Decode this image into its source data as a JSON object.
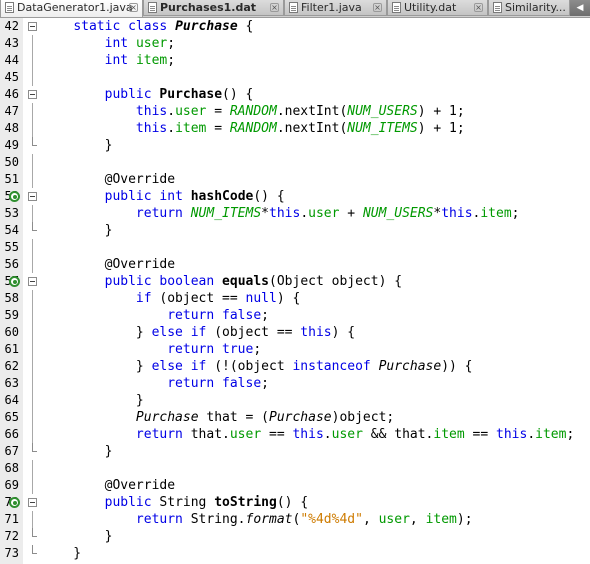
{
  "tabs": [
    {
      "label": "DataGenerator1.java",
      "active": true,
      "bold": false,
      "close": "×"
    },
    {
      "label": "Purchases1.dat",
      "active": false,
      "bold": true,
      "close": "×"
    },
    {
      "label": "Filter1.java",
      "active": false,
      "bold": false,
      "close": "×"
    },
    {
      "label": "Utility.dat",
      "active": false,
      "bold": false,
      "close": "×"
    },
    {
      "label": "Similarity...",
      "active": false,
      "bold": false,
      "close": "×"
    }
  ],
  "tab_scroll_arrow": "◀",
  "code_lines": [
    {
      "num": "42",
      "fold": "start",
      "tokens": [
        [
          "plain",
          "    "
        ],
        [
          "kw",
          "static"
        ],
        [
          "plain",
          " "
        ],
        [
          "kw",
          "class"
        ],
        [
          "plain",
          " "
        ],
        [
          "bcls",
          "Purchase"
        ],
        [
          "plain",
          " {"
        ]
      ]
    },
    {
      "num": "43",
      "fold": "line",
      "tokens": [
        [
          "plain",
          "        "
        ],
        [
          "kw",
          "int"
        ],
        [
          "plain",
          " "
        ],
        [
          "field",
          "user"
        ],
        [
          "plain",
          ";"
        ]
      ]
    },
    {
      "num": "44",
      "fold": "line",
      "tokens": [
        [
          "plain",
          "        "
        ],
        [
          "kw",
          "int"
        ],
        [
          "plain",
          " "
        ],
        [
          "field",
          "item"
        ],
        [
          "plain",
          ";"
        ]
      ]
    },
    {
      "num": "45",
      "fold": "line",
      "tokens": []
    },
    {
      "num": "46",
      "fold": "start",
      "tokens": [
        [
          "plain",
          "        "
        ],
        [
          "kw",
          "public"
        ],
        [
          "plain",
          " "
        ],
        [
          "meth",
          "Purchase"
        ],
        [
          "plain",
          "() {"
        ]
      ]
    },
    {
      "num": "47",
      "fold": "line",
      "tokens": [
        [
          "plain",
          "            "
        ],
        [
          "kw",
          "this"
        ],
        [
          "plain",
          "."
        ],
        [
          "field",
          "user"
        ],
        [
          "plain",
          " = "
        ],
        [
          "const",
          "RANDOM"
        ],
        [
          "plain",
          ".nextInt("
        ],
        [
          "const",
          "NUM_USERS"
        ],
        [
          "plain",
          ") + 1;"
        ]
      ]
    },
    {
      "num": "48",
      "fold": "line",
      "tokens": [
        [
          "plain",
          "            "
        ],
        [
          "kw",
          "this"
        ],
        [
          "plain",
          "."
        ],
        [
          "field",
          "item"
        ],
        [
          "plain",
          " = "
        ],
        [
          "const",
          "RANDOM"
        ],
        [
          "plain",
          ".nextInt("
        ],
        [
          "const",
          "NUM_ITEMS"
        ],
        [
          "plain",
          ") + 1;"
        ]
      ]
    },
    {
      "num": "49",
      "fold": "end",
      "tokens": [
        [
          "plain",
          "        }"
        ]
      ]
    },
    {
      "num": "50",
      "fold": "line",
      "tokens": []
    },
    {
      "num": "51",
      "fold": "line",
      "tokens": [
        [
          "plain",
          "        "
        ],
        [
          "ann",
          "@Override"
        ]
      ]
    },
    {
      "num": "52",
      "fold": "start",
      "override": true,
      "tokens": [
        [
          "plain",
          "        "
        ],
        [
          "kw",
          "public"
        ],
        [
          "plain",
          " "
        ],
        [
          "kw",
          "int"
        ],
        [
          "plain",
          " "
        ],
        [
          "meth",
          "hashCode"
        ],
        [
          "plain",
          "() {"
        ]
      ]
    },
    {
      "num": "53",
      "fold": "line",
      "tokens": [
        [
          "plain",
          "            "
        ],
        [
          "kw",
          "return"
        ],
        [
          "plain",
          " "
        ],
        [
          "const",
          "NUM_ITEMS"
        ],
        [
          "plain",
          "*"
        ],
        [
          "kw",
          "this"
        ],
        [
          "plain",
          "."
        ],
        [
          "field",
          "user"
        ],
        [
          "plain",
          " + "
        ],
        [
          "const",
          "NUM_USERS"
        ],
        [
          "plain",
          "*"
        ],
        [
          "kw",
          "this"
        ],
        [
          "plain",
          "."
        ],
        [
          "field",
          "item"
        ],
        [
          "plain",
          ";"
        ]
      ]
    },
    {
      "num": "54",
      "fold": "end",
      "tokens": [
        [
          "plain",
          "        }"
        ]
      ]
    },
    {
      "num": "55",
      "fold": "line",
      "tokens": []
    },
    {
      "num": "56",
      "fold": "line",
      "tokens": [
        [
          "plain",
          "        "
        ],
        [
          "ann",
          "@Override"
        ]
      ]
    },
    {
      "num": "57",
      "fold": "start",
      "override": true,
      "tokens": [
        [
          "plain",
          "        "
        ],
        [
          "kw",
          "public"
        ],
        [
          "plain",
          " "
        ],
        [
          "kw",
          "boolean"
        ],
        [
          "plain",
          " "
        ],
        [
          "meth",
          "equals"
        ],
        [
          "plain",
          "(Object object) {"
        ]
      ]
    },
    {
      "num": "58",
      "fold": "line",
      "tokens": [
        [
          "plain",
          "            "
        ],
        [
          "kw",
          "if"
        ],
        [
          "plain",
          " (object == "
        ],
        [
          "kw",
          "null"
        ],
        [
          "plain",
          ") {"
        ]
      ]
    },
    {
      "num": "59",
      "fold": "line",
      "tokens": [
        [
          "plain",
          "                "
        ],
        [
          "kw",
          "return"
        ],
        [
          "plain",
          " "
        ],
        [
          "kw",
          "false"
        ],
        [
          "plain",
          ";"
        ]
      ]
    },
    {
      "num": "60",
      "fold": "line",
      "tokens": [
        [
          "plain",
          "            } "
        ],
        [
          "kw",
          "else"
        ],
        [
          "plain",
          " "
        ],
        [
          "kw",
          "if"
        ],
        [
          "plain",
          " (object == "
        ],
        [
          "kw",
          "this"
        ],
        [
          "plain",
          ") {"
        ]
      ]
    },
    {
      "num": "61",
      "fold": "line",
      "tokens": [
        [
          "plain",
          "                "
        ],
        [
          "kw",
          "return"
        ],
        [
          "plain",
          " "
        ],
        [
          "kw",
          "true"
        ],
        [
          "plain",
          ";"
        ]
      ]
    },
    {
      "num": "62",
      "fold": "line",
      "tokens": [
        [
          "plain",
          "            } "
        ],
        [
          "kw",
          "else"
        ],
        [
          "plain",
          " "
        ],
        [
          "kw",
          "if"
        ],
        [
          "plain",
          " (!(object "
        ],
        [
          "kw",
          "instanceof"
        ],
        [
          "plain",
          " "
        ],
        [
          "cls",
          "Purchase"
        ],
        [
          "plain",
          ")) {"
        ]
      ]
    },
    {
      "num": "63",
      "fold": "line",
      "tokens": [
        [
          "plain",
          "                "
        ],
        [
          "kw",
          "return"
        ],
        [
          "plain",
          " "
        ],
        [
          "kw",
          "false"
        ],
        [
          "plain",
          ";"
        ]
      ]
    },
    {
      "num": "64",
      "fold": "line",
      "tokens": [
        [
          "plain",
          "            }"
        ]
      ]
    },
    {
      "num": "65",
      "fold": "line",
      "tokens": [
        [
          "plain",
          "            "
        ],
        [
          "cls",
          "Purchase"
        ],
        [
          "plain",
          " that = ("
        ],
        [
          "cls",
          "Purchase"
        ],
        [
          "plain",
          ")object;"
        ]
      ]
    },
    {
      "num": "66",
      "fold": "line",
      "tokens": [
        [
          "plain",
          "            "
        ],
        [
          "kw",
          "return"
        ],
        [
          "plain",
          " that."
        ],
        [
          "field",
          "user"
        ],
        [
          "plain",
          " == "
        ],
        [
          "kw",
          "this"
        ],
        [
          "plain",
          "."
        ],
        [
          "field",
          "user"
        ],
        [
          "plain",
          " && that."
        ],
        [
          "field",
          "item"
        ],
        [
          "plain",
          " == "
        ],
        [
          "kw",
          "this"
        ],
        [
          "plain",
          "."
        ],
        [
          "field",
          "item"
        ],
        [
          "plain",
          ";"
        ]
      ]
    },
    {
      "num": "67",
      "fold": "end",
      "tokens": [
        [
          "plain",
          "        }"
        ]
      ]
    },
    {
      "num": "68",
      "fold": "line",
      "tokens": []
    },
    {
      "num": "69",
      "fold": "line",
      "tokens": [
        [
          "plain",
          "        "
        ],
        [
          "ann",
          "@Override"
        ]
      ]
    },
    {
      "num": "70",
      "fold": "start",
      "override": true,
      "tokens": [
        [
          "plain",
          "        "
        ],
        [
          "kw",
          "public"
        ],
        [
          "plain",
          " String "
        ],
        [
          "meth",
          "toString"
        ],
        [
          "plain",
          "() {"
        ]
      ]
    },
    {
      "num": "71",
      "fold": "line",
      "tokens": [
        [
          "plain",
          "            "
        ],
        [
          "kw",
          "return"
        ],
        [
          "plain",
          " String."
        ],
        [
          "smeth",
          "format"
        ],
        [
          "plain",
          "("
        ],
        [
          "str",
          "\"%4d%4d\""
        ],
        [
          "plain",
          ", "
        ],
        [
          "field",
          "user"
        ],
        [
          "plain",
          ", "
        ],
        [
          "field",
          "item"
        ],
        [
          "plain",
          ");"
        ]
      ]
    },
    {
      "num": "72",
      "fold": "end",
      "tokens": [
        [
          "plain",
          "        }"
        ]
      ]
    },
    {
      "num": "73",
      "fold": "end",
      "tokens": [
        [
          "plain",
          "    }"
        ]
      ]
    }
  ],
  "colors": {
    "keyword": "#0000e6",
    "field": "#009900",
    "string": "#ce7b00",
    "override_marker": "#2f8f2f"
  },
  "icons": {
    "tab": "java-file-icon",
    "close": "close-icon",
    "fold": "fold-toggle-icon",
    "override": "override-marker-icon"
  }
}
